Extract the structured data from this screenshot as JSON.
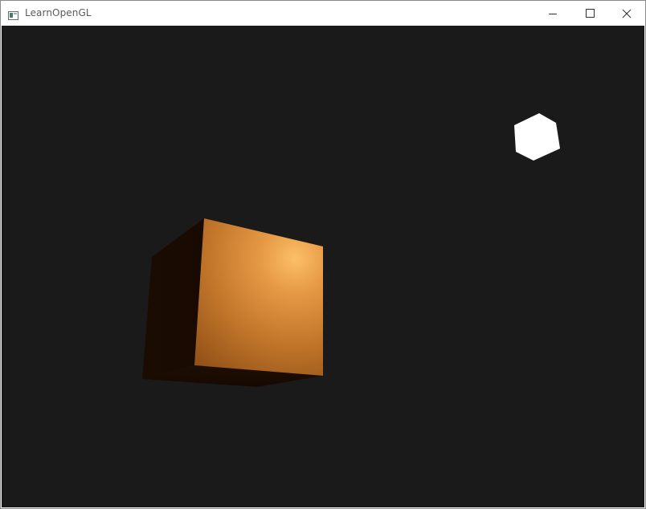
{
  "window": {
    "title": "LearnOpenGL",
    "app_icon": "window-app-icon",
    "controls": {
      "minimize_icon": "minimize-icon",
      "maximize_icon": "maximize-icon",
      "close_icon": "close-icon"
    }
  },
  "scene": {
    "background_color": "#1a1a1a",
    "objects": [
      {
        "name": "lit-cube",
        "type": "cube",
        "base_color": "#c87a2e",
        "highlight_color": "#fcbf68",
        "shadow_color": "#1c0c02"
      },
      {
        "name": "light-source-cube",
        "type": "cube",
        "color": "#ffffff"
      }
    ]
  }
}
